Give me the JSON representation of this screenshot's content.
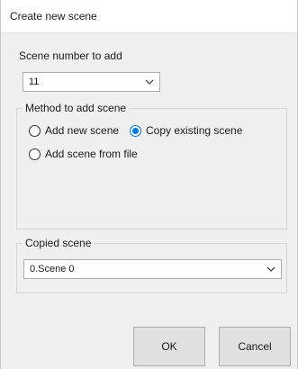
{
  "window": {
    "title": "Create new scene"
  },
  "scene_number": {
    "label": "Scene number to add",
    "selected": "11",
    "icon": "chevron-down-icon"
  },
  "method": {
    "legend": "Method to add scene",
    "options": [
      {
        "label": "Add new scene",
        "checked": false
      },
      {
        "label": "Copy existing scene",
        "checked": true
      },
      {
        "label": "Add scene from file",
        "checked": false
      }
    ]
  },
  "copied_scene": {
    "legend": "Copied scene",
    "selected": "0.Scene 0",
    "icon": "chevron-down-icon"
  },
  "buttons": {
    "ok_label": "OK",
    "cancel_label": "Cancel"
  },
  "colors": {
    "accent": "#0078d7",
    "dialog_bg": "#f0f0f0",
    "titlebar_bg": "#ffffff"
  }
}
